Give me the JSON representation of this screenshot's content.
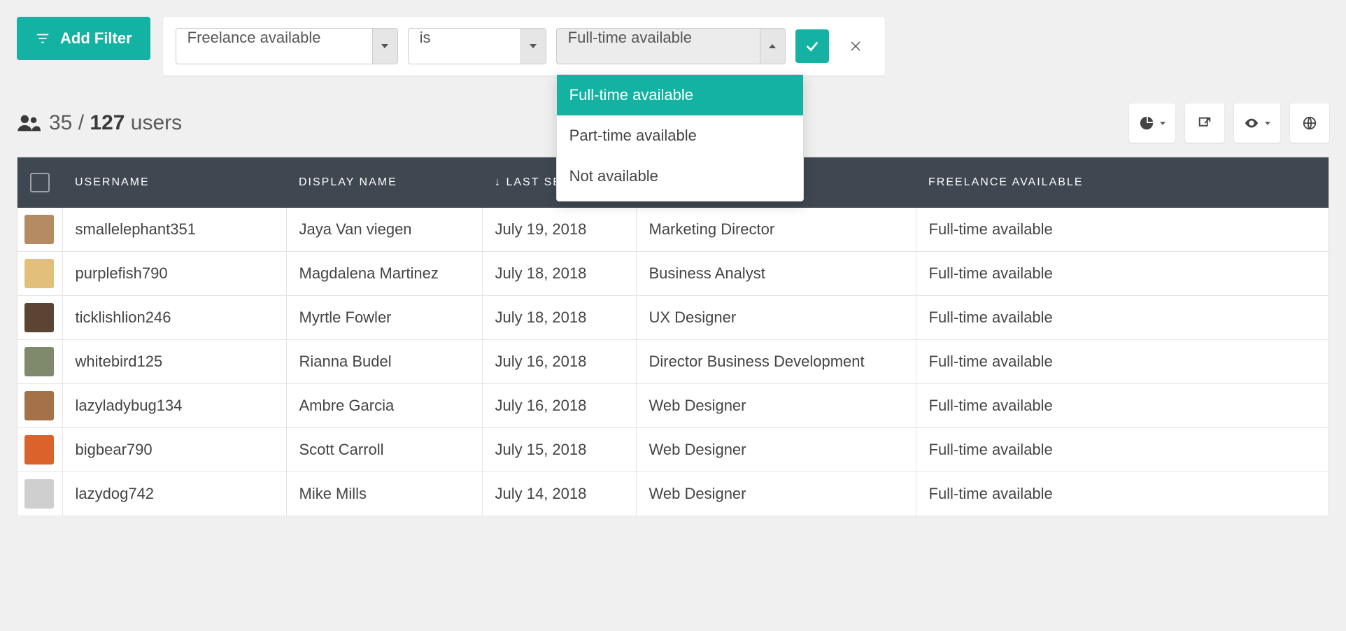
{
  "toolbar": {
    "add_filter_label": "Add Filter"
  },
  "filter": {
    "field": "Freelance available",
    "operator": "is",
    "value": "Full-time available",
    "options": [
      "Full-time available",
      "Part-time available",
      "Not available"
    ]
  },
  "summary": {
    "filtered": "35",
    "total": "127",
    "unit": "users"
  },
  "table": {
    "columns": {
      "username": "Username",
      "display_name": "Display Name",
      "last_seen_prefix": "↓",
      "last_seen": "Last Seen",
      "freelance": "Freelance Available"
    },
    "rows": [
      {
        "avatar_color": "#b58b63",
        "username": "smallelephant351",
        "display_name": "Jaya Van viegen",
        "last_seen": "July 19, 2018",
        "specialization": "Marketing Director",
        "freelance": "Full-time available"
      },
      {
        "avatar_color": "#e3c07a",
        "username": "purplefish790",
        "display_name": "Magdalena Martinez",
        "last_seen": "July 18, 2018",
        "specialization": "Business Analyst",
        "freelance": "Full-time available"
      },
      {
        "avatar_color": "#5b4433",
        "username": "ticklishlion246",
        "display_name": "Myrtle Fowler",
        "last_seen": "July 18, 2018",
        "specialization": "UX Designer",
        "freelance": "Full-time available"
      },
      {
        "avatar_color": "#7f8a6d",
        "username": "whitebird125",
        "display_name": "Rianna Budel",
        "last_seen": "July 16, 2018",
        "specialization": "Director Business Development",
        "freelance": "Full-time available"
      },
      {
        "avatar_color": "#a57148",
        "username": "lazyladybug134",
        "display_name": "Ambre Garcia",
        "last_seen": "July 16, 2018",
        "specialization": "Web Designer",
        "freelance": "Full-time available"
      },
      {
        "avatar_color": "#d9632a",
        "username": "bigbear790",
        "display_name": "Scott Carroll",
        "last_seen": "July 15, 2018",
        "specialization": "Web Designer",
        "freelance": "Full-time available"
      },
      {
        "avatar_color": "#cfcfcf",
        "username": "lazydog742",
        "display_name": "Mike Mills",
        "last_seen": "July 14, 2018",
        "specialization": "Web Designer",
        "freelance": "Full-time available"
      }
    ]
  }
}
